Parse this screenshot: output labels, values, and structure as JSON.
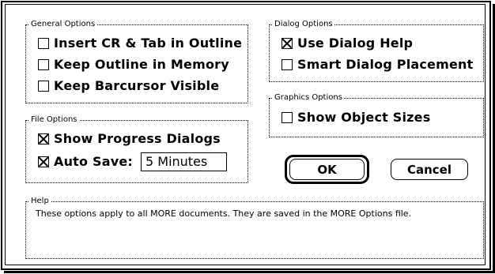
{
  "general_options": {
    "title": "General Options",
    "items": [
      {
        "label": "Insert CR & Tab in Outline",
        "checked": false
      },
      {
        "label": "Keep Outline in Memory",
        "checked": false
      },
      {
        "label": "Keep Barcursor Visible",
        "checked": false
      }
    ]
  },
  "dialog_options": {
    "title": "Dialog Options",
    "items": [
      {
        "label": "Use Dialog Help",
        "checked": true
      },
      {
        "label": "Smart Dialog Placement",
        "checked": false
      }
    ]
  },
  "graphics_options": {
    "title": "Graphics Options",
    "items": [
      {
        "label": "Show Object Sizes",
        "checked": false
      }
    ]
  },
  "file_options": {
    "title": "File Options",
    "items": [
      {
        "label": "Show Progress Dialogs",
        "checked": true
      },
      {
        "label": "Auto Save:",
        "checked": true
      }
    ],
    "auto_save_value": "5 Minutes"
  },
  "buttons": {
    "ok": "OK",
    "cancel": "Cancel"
  },
  "help": {
    "title": "Help",
    "text": "These options apply to all MORE documents.  They are saved in the MORE Options file."
  }
}
